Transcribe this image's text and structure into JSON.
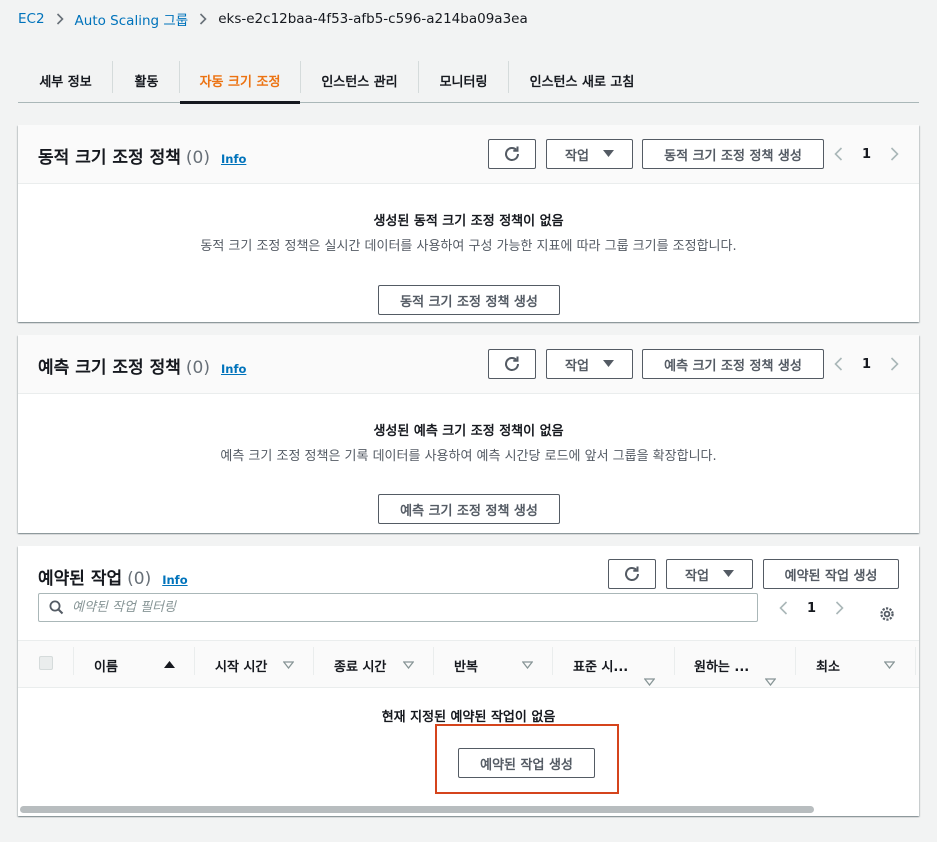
{
  "breadcrumb": {
    "items": [
      "EC2",
      "Auto Scaling 그룹"
    ],
    "current": "eks-e2c12baa-4f53-afb5-c596-a214ba09a3ea"
  },
  "tabs": [
    {
      "label": "세부 정보"
    },
    {
      "label": "활동"
    },
    {
      "label": "자동 크기 조정",
      "active": true
    },
    {
      "label": "인스턴스 관리"
    },
    {
      "label": "모니터링"
    },
    {
      "label": "인스턴스 새로 고침"
    }
  ],
  "dynamic": {
    "title": "동적 크기 조정 정책",
    "count": "(0)",
    "info": "Info",
    "actions_label": "작업",
    "create_label": "동적 크기 조정 정책 생성",
    "page": "1",
    "empty_title": "생성된 동적 크기 조정 정책이 없음",
    "empty_desc": "동적 크기 조정 정책은 실시간 데이터를 사용하여 구성 가능한 지표에 따라 그룹 크기를 조정합니다.",
    "empty_button": "동적 크기 조정 정책 생성"
  },
  "predictive": {
    "title": "예측 크기 조정 정책",
    "count": "(0)",
    "info": "Info",
    "actions_label": "작업",
    "create_label": "예측 크기 조정 정책 생성",
    "page": "1",
    "empty_title": "생성된 예측 크기 조정 정책이 없음",
    "empty_desc": "예측 크기 조정 정책은 기록 데이터를 사용하여 예측 시간당 로드에 앞서 그룹을 확장합니다.",
    "empty_button": "예측 크기 조정 정책 생성"
  },
  "scheduled": {
    "title": "예약된 작업",
    "count": "(0)",
    "info": "Info",
    "actions_label": "작업",
    "create_label": "예약된 작업 생성",
    "filter_placeholder": "예약된 작업 필터링",
    "page": "1",
    "columns": [
      "이름",
      "시작 시간",
      "종료 시간",
      "반복",
      "표준 시...",
      "원하는 ...",
      "최소"
    ],
    "empty_title": "현재 지정된 예약된 작업이 없음",
    "empty_button": "예약된 작업 생성"
  },
  "colors": {
    "accent": "#ec7211",
    "link": "#0073bb",
    "highlight": "#d5441c"
  },
  "icons": [
    "chevron-right-icon",
    "refresh-icon",
    "caret-down-icon",
    "chevron-left-icon",
    "search-icon",
    "settings-gear-icon",
    "sort-asc-icon",
    "sort-desc-icon"
  ]
}
